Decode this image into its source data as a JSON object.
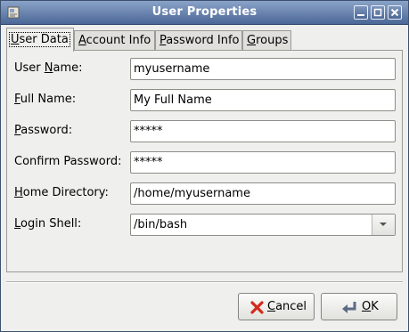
{
  "window": {
    "title": "User Properties"
  },
  "titlebar_buttons": [
    "minimize",
    "maximize",
    "close"
  ],
  "tabs": [
    {
      "pre": "",
      "mnemonic": "U",
      "post": "ser Data",
      "active": true
    },
    {
      "pre": "",
      "mnemonic": "A",
      "post": "ccount Info",
      "active": false
    },
    {
      "pre": "",
      "mnemonic": "P",
      "post": "assword Info",
      "active": false
    },
    {
      "pre": "",
      "mnemonic": "G",
      "post": "roups",
      "active": false
    }
  ],
  "form": {
    "user_name": {
      "label_pre": "User ",
      "label_mn": "N",
      "label_post": "ame:",
      "value": "myusername"
    },
    "full_name": {
      "label_pre": "",
      "label_mn": "F",
      "label_post": "ull Name:",
      "value": "My Full Name"
    },
    "password": {
      "label_pre": "",
      "label_mn": "P",
      "label_post": "assword:",
      "value": "*****"
    },
    "confirm_password": {
      "label_pre": "Conf",
      "label_mn": "i",
      "label_post": "rm Password:",
      "value": "*****"
    },
    "home_directory": {
      "label_pre": "",
      "label_mn": "H",
      "label_post": "ome Directory:",
      "value": "/home/myusername"
    },
    "login_shell": {
      "label_pre": "",
      "label_mn": "L",
      "label_post": "ogin Shell:",
      "value": "/bin/bash"
    }
  },
  "buttons": {
    "cancel": {
      "pre": "",
      "mn": "C",
      "post": "ancel",
      "icon": "red-x-icon"
    },
    "ok": {
      "pre": "",
      "mn": "O",
      "post": "K",
      "icon": "return-arrow-icon"
    }
  },
  "colors": {
    "titlebar": "#4b6796",
    "window_bg": "#efefee",
    "cancel_icon": "#d42a1e"
  }
}
